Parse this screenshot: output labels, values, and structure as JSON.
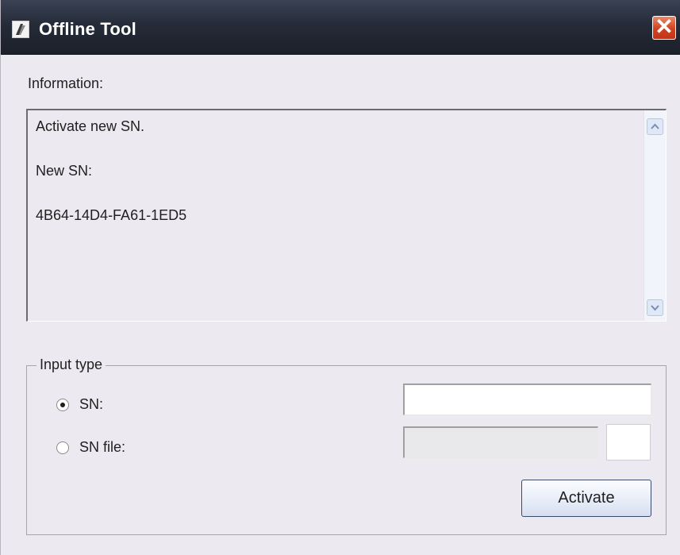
{
  "window": {
    "title": "Offline Tool",
    "close_glyph": "✕"
  },
  "info": {
    "label": "Information:",
    "lines": [
      "Activate new SN.",
      "New SN:",
      "4B64-14D4-FA61-1ED5"
    ]
  },
  "input_type": {
    "legend": "Input type",
    "options": [
      {
        "label": "SN:",
        "selected": true
      },
      {
        "label": "SN file:",
        "selected": false
      }
    ],
    "sn_value": "",
    "sn_file_value": ""
  },
  "actions": {
    "activate_label": "Activate"
  },
  "colors": {
    "title_bar": "#252b38",
    "close_button": "#d2411f",
    "window_bg": "#eceaf0"
  }
}
